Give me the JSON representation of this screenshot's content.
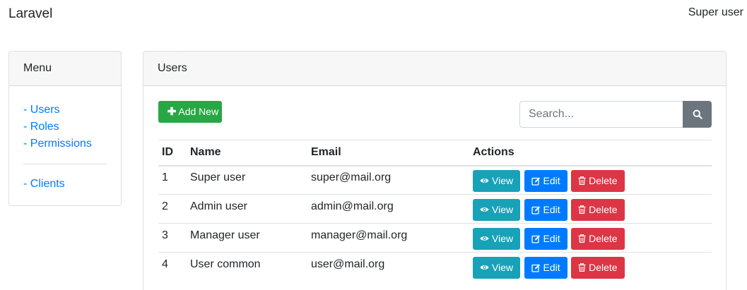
{
  "navbar": {
    "brand": "Laravel",
    "user_name": "Super user"
  },
  "menu": {
    "title": "Menu",
    "items": [
      {
        "label": "- Users"
      },
      {
        "label": "- Roles"
      },
      {
        "label": "- Permissions"
      }
    ],
    "extra_items": [
      {
        "label": "- Clients"
      }
    ]
  },
  "users_panel": {
    "title": "Users",
    "add_button_label": "Add New",
    "add_button_icon": "plus-icon",
    "search": {
      "placeholder": "Search...",
      "value": "",
      "button_icon": "search-icon"
    },
    "table": {
      "headers": {
        "id": "ID",
        "name": "Name",
        "email": "Email",
        "actions": "Actions"
      },
      "rows": [
        {
          "id": "1",
          "name": "Super user",
          "email": "super@mail.org"
        },
        {
          "id": "2",
          "name": "Admin user",
          "email": "admin@mail.org"
        },
        {
          "id": "3",
          "name": "Manager user",
          "email": "manager@mail.org"
        },
        {
          "id": "4",
          "name": "User common",
          "email": "user@mail.org"
        }
      ],
      "actions": {
        "view": {
          "label": "View",
          "icon": "eye-icon",
          "color": "#17a2b8"
        },
        "edit": {
          "label": "Edit",
          "icon": "edit-icon",
          "color": "#007bff"
        },
        "delete": {
          "label": "Delete",
          "icon": "trash-icon",
          "color": "#dc3545"
        }
      }
    }
  },
  "colors": {
    "link": "#007bff",
    "success": "#28a745",
    "secondary": "#6c757d"
  }
}
